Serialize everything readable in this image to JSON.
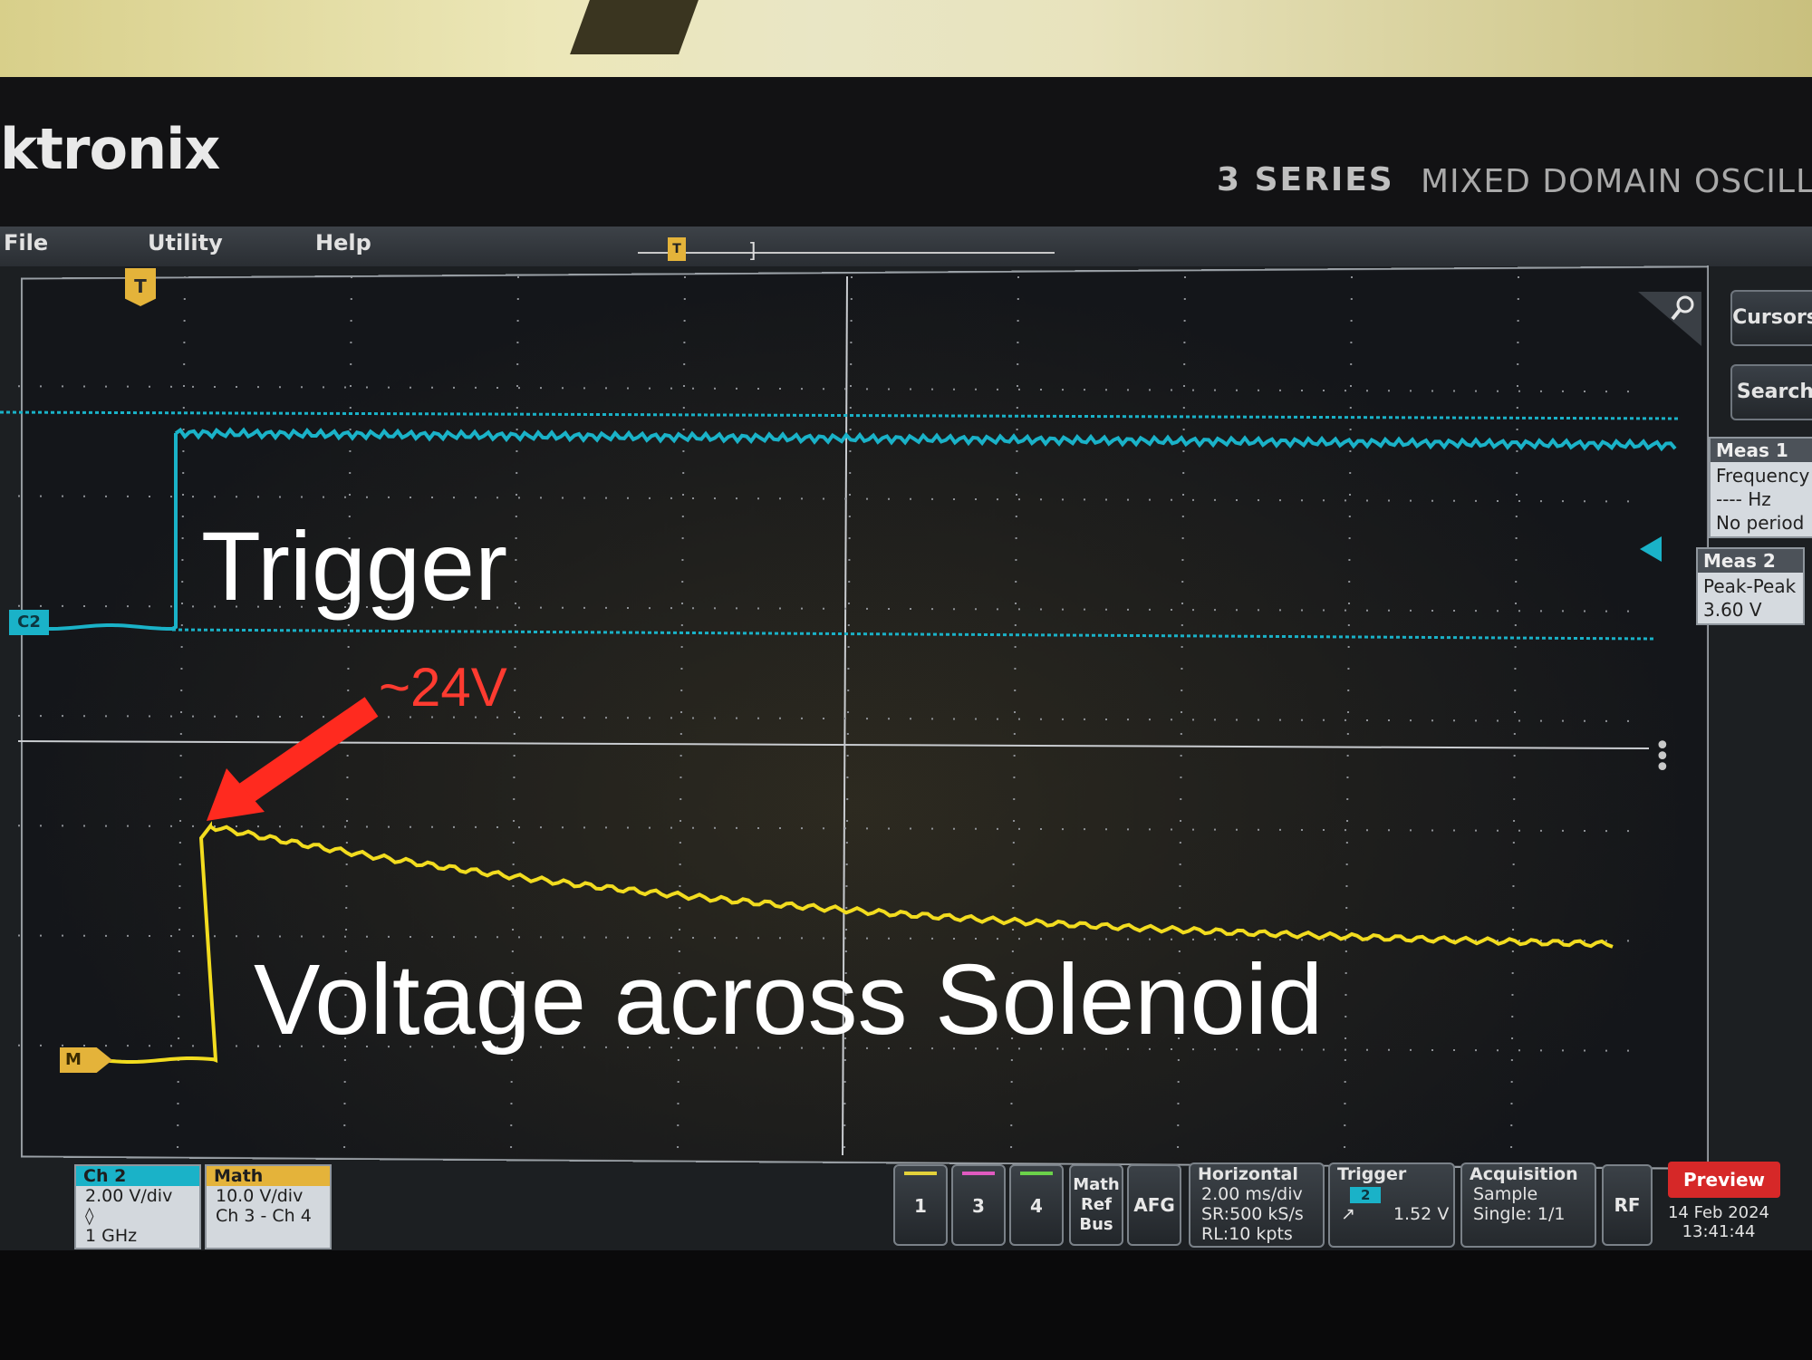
{
  "header": {
    "brand": "ktronix",
    "series": "3 SERIES",
    "model": "MIXED DOMAIN OSCILL"
  },
  "menu": {
    "file": "File",
    "utility": "Utility",
    "help": "Help"
  },
  "markers": {
    "trigger_marker": "T",
    "timeline_marker": "T"
  },
  "channel_tags": {
    "ch2": "C2",
    "math": "M"
  },
  "side_buttons": {
    "cursors": "Cursors",
    "search": "Search"
  },
  "measurements": [
    {
      "title": "Meas 1",
      "type": "Frequency",
      "value": "---- Hz",
      "note": "No period"
    },
    {
      "title": "Meas 2",
      "type": "Peak-Peak",
      "value": "3.60 V"
    }
  ],
  "badges": {
    "ch2": {
      "title": "Ch 2",
      "scale": "2.00 V/div",
      "bandwidth": "1 GHz"
    },
    "math": {
      "title": "Math",
      "scale": "10.0 V/div",
      "expr": "Ch 3 - Ch 4"
    }
  },
  "channel_buttons": [
    {
      "label": "1",
      "color": "#e4d23a"
    },
    {
      "label": "3",
      "color": "#e05ac0"
    },
    {
      "label": "4",
      "color": "#6bd24a"
    }
  ],
  "math_ref_bus": [
    "Math",
    "Ref",
    "Bus"
  ],
  "afg": "AFG",
  "horizontal": {
    "title": "Horizontal",
    "scale": "2.00 ms/div",
    "sample_rate": "SR:500 kS/s",
    "record_length": "RL:10 kpts"
  },
  "trigger": {
    "title": "Trigger",
    "source": "2",
    "level": "1.52 V"
  },
  "acquisition": {
    "title": "Acquisition",
    "mode": "Sample",
    "single": "Single: 1/1"
  },
  "rf": "RF",
  "preview": "Preview",
  "datetime": {
    "date": "14 Feb 2024",
    "time": "13:41:44"
  },
  "annotations": {
    "trigger_label": "Trigger",
    "solenoid_label": "Voltage across Solenoid",
    "peak_label": "~24V"
  },
  "colors": {
    "ch2_trace": "#1ab2c8",
    "math_trace": "#f2dc1f",
    "annotation_arrow": "#ff2a1f",
    "preview": "#d62828"
  }
}
